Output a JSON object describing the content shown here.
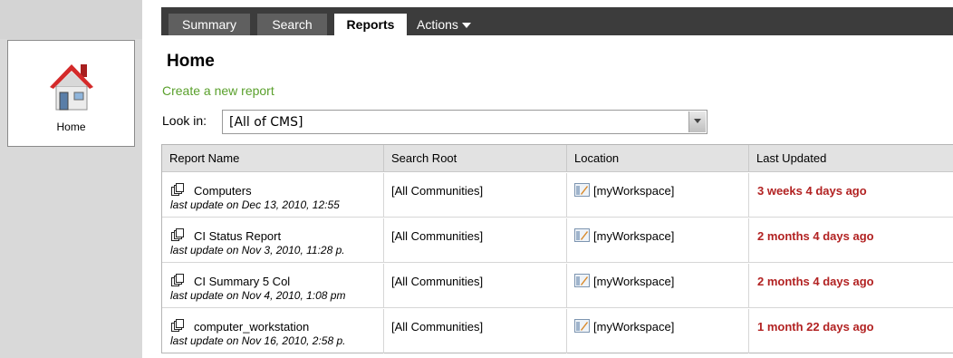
{
  "sidebar": {
    "home_label": "Home"
  },
  "tabs": {
    "summary": "Summary",
    "search": "Search",
    "reports": "Reports",
    "actions": "Actions"
  },
  "page": {
    "title": "Home",
    "create_link": "Create a new report",
    "lookin_label": "Look in:",
    "lookin_value": "[All of CMS]"
  },
  "table": {
    "headers": [
      "Report Name",
      "Search Root",
      "Location",
      "Last Updated"
    ],
    "rows": [
      {
        "name": "Computers",
        "sub": "last update on Dec 13, 2010, 12:55",
        "root": "[All Communities]",
        "location": "[myWorkspace]",
        "updated": "3 weeks 4 days ago"
      },
      {
        "name": "CI Status Report",
        "sub": "last update on Nov 3, 2010, 11:28 p.",
        "root": "[All Communities]",
        "location": "[myWorkspace]",
        "updated": "2 months 4 days ago"
      },
      {
        "name": "CI Summary 5 Col",
        "sub": "last update on Nov 4, 2010, 1:08 pm",
        "root": "[All Communities]",
        "location": "[myWorkspace]",
        "updated": "2 months 4 days ago"
      },
      {
        "name": "computer_workstation",
        "sub": "last update on Nov 16, 2010, 2:58 p.",
        "root": "[All Communities]",
        "location": "[myWorkspace]",
        "updated": "1 month 22 days ago"
      }
    ]
  },
  "colors": {
    "topbar": "#3c3c3c",
    "link_green": "#5aa02c",
    "updated_red": "#b22222",
    "house_roof": "#d42a2a"
  }
}
